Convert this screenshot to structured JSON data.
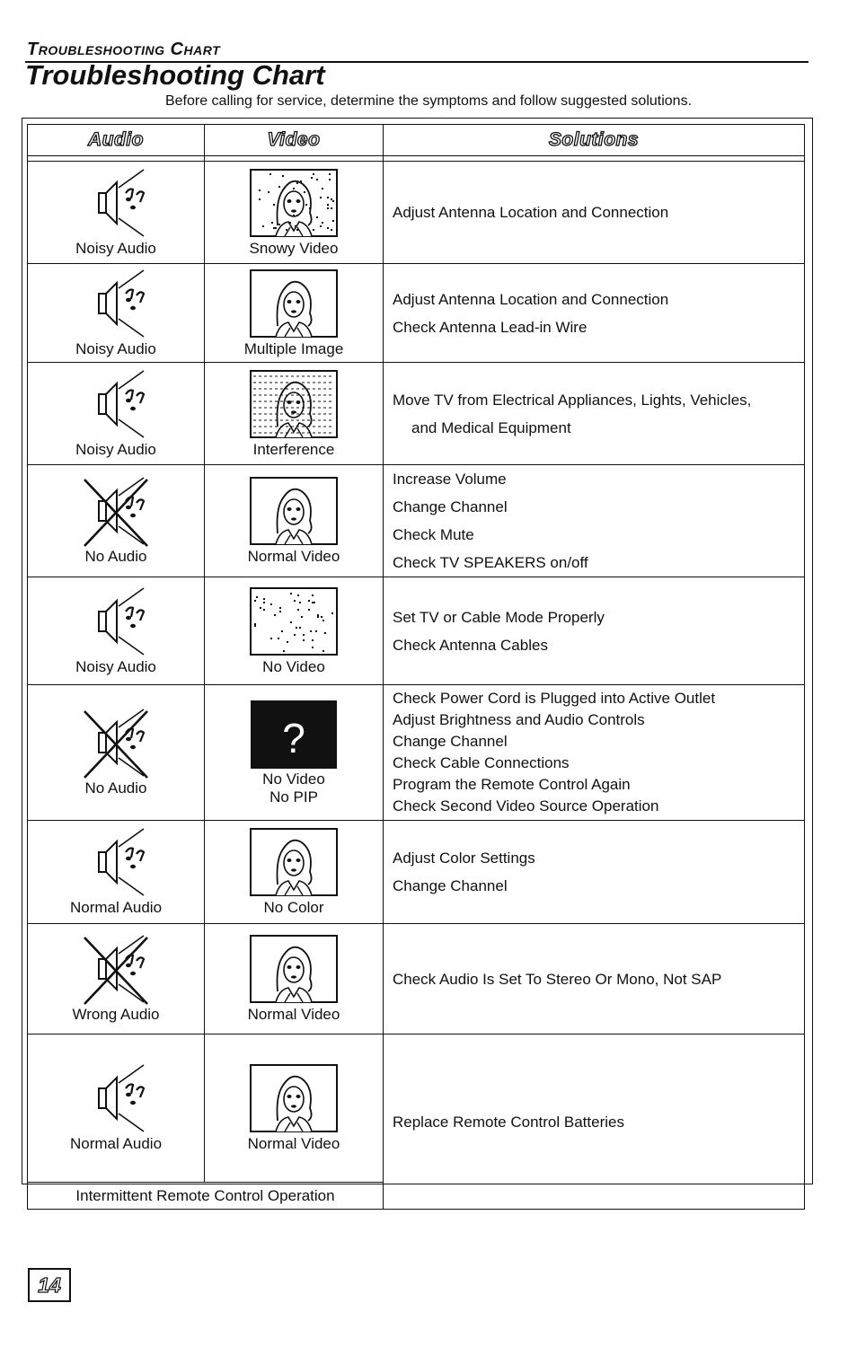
{
  "header": {
    "running_title": "Troubleshooting Chart",
    "title": "Troubleshooting Chart",
    "intro": "Before calling for service, determine the symptoms and follow suggested solutions."
  },
  "columns": {
    "audio": "Audio",
    "video": "Video",
    "solutions": "Solutions"
  },
  "rows": [
    {
      "audio_icon": "noisy-audio-icon",
      "audio": "Noisy Audio",
      "video_icon": "snowy-video-icon",
      "video": "Snowy Video",
      "solutions": [
        "Adjust Antenna Location and Connection"
      ]
    },
    {
      "audio_icon": "noisy-audio-icon",
      "audio": "Noisy Audio",
      "video_icon": "multiple-image-icon",
      "video": "Multiple Image",
      "solutions": [
        "Adjust Antenna Location and Connection",
        "Check Antenna Lead-in Wire"
      ]
    },
    {
      "audio_icon": "noisy-audio-icon",
      "audio": "Noisy Audio",
      "video_icon": "interference-icon",
      "video": "Interference",
      "solutions": [
        "Move TV from Electrical Appliances, Lights, Vehicles,",
        "and Medical Equipment"
      ]
    },
    {
      "audio_icon": "no-audio-icon",
      "audio": "No Audio",
      "video_icon": "normal-video-icon",
      "video": "Normal Video",
      "solutions": [
        "Increase Volume",
        "Change Channel",
        "Check Mute",
        "Check TV SPEAKERS on/off"
      ]
    },
    {
      "audio_icon": "noisy-audio-icon",
      "audio": "Noisy Audio",
      "video_icon": "no-video-icon",
      "video": "No Video",
      "solutions": [
        "Set TV or Cable Mode Properly",
        "Check Antenna Cables"
      ]
    },
    {
      "audio_icon": "no-audio-icon",
      "audio": "No Audio",
      "video_icon": "no-pip-icon",
      "video": "No Video",
      "video2": "No PIP",
      "solutions": [
        "Check Power Cord is Plugged into Active Outlet",
        "Adjust Brightness and Audio Controls",
        "Change Channel",
        "Check Cable Connections",
        "Program the Remote Control Again",
        "Check Second Video Source Operation"
      ]
    },
    {
      "audio_icon": "normal-audio-icon",
      "audio": "Normal Audio",
      "video_icon": "no-color-icon",
      "video": "No Color",
      "solutions": [
        "Adjust Color Settings",
        "Change Channel"
      ]
    },
    {
      "audio_icon": "wrong-audio-icon",
      "audio": "Wrong Audio",
      "video_icon": "normal-video-icon",
      "video": "Normal Video",
      "solutions": [
        "Check Audio Is Set To Stereo Or Mono, Not SAP"
      ]
    },
    {
      "audio_icon": "normal-audio-icon",
      "audio": "Normal Audio",
      "video_icon": "normal-video-icon",
      "video": "Normal Video",
      "note": "Intermittent Remote Control Operation",
      "solutions": [
        "Replace Remote Control Batteries"
      ]
    }
  ],
  "page_number": "14",
  "ui": {
    "question_mark": "?"
  }
}
